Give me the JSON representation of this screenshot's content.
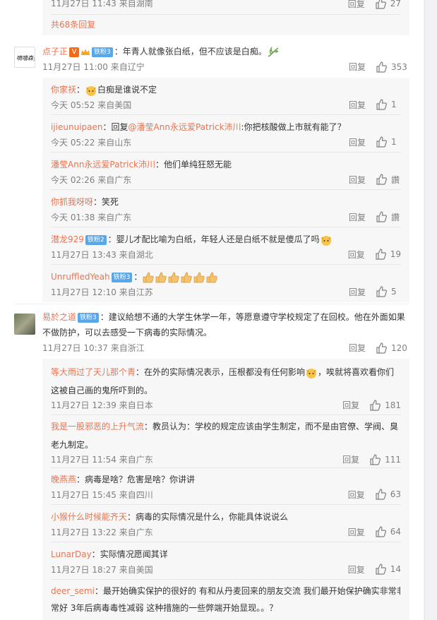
{
  "top_partial": {
    "meta": "11月27日 11:43 来自湖南",
    "reply": "回复",
    "likes": "27"
  },
  "more_replies": "共68条回复",
  "comments": [
    {
      "user": "点子正",
      "badge": "铁粉3",
      "text": "年青人就像张白纸，但不应该是白痴。",
      "meta": "11月27日 11:00 来自辽宁",
      "reply": "回复",
      "likes": "353",
      "replies": [
        {
          "user": "你家祆",
          "text_pre": "",
          "text": "白痴是谁说不定",
          "meta": "今天 05:52 来自美国",
          "reply": "回复",
          "likes": "1"
        },
        {
          "user": "ijieunuipaen",
          "text_pre": "回复",
          "mention": "@潘莹Ann永远爱Patrick沛川",
          "text": ":你把核酸做上市就有能了？",
          "meta": "今天 05:22 来自山东",
          "reply": "回复",
          "likes": "1"
        },
        {
          "user": "潘莹Ann永远爱Patrick沛川",
          "text_pre": "",
          "text": "他们单纯狂怒无能",
          "meta": "今天 02:26 来自广东",
          "reply": "回复",
          "likes": "讚"
        },
        {
          "user": "你抓我呀呀",
          "text_pre": "",
          "text": "笑死",
          "meta": "今天 01:38 来自广东",
          "reply": "回复",
          "likes": "讚"
        },
        {
          "user": "潜龙929",
          "badge": "铁粉2",
          "text_pre": "",
          "text": "婴儿才配比喻为白纸，年轻人还是白纸不就是傻瓜了吗",
          "meta": "11月27日 13:43 来自湖北",
          "reply": "回复",
          "likes": "19"
        },
        {
          "user": "UnruffledYeah",
          "badge": "铁粉3",
          "text_pre": "",
          "text": "",
          "meta": "11月27日 12:10 来自江苏",
          "reply": "回复",
          "likes": "5"
        }
      ]
    },
    {
      "user": "易於之道",
      "badge": "铁粉3",
      "text_line1": "建议給想不通的大学生休学一年，等愿意遵守学校规定了在回校。他在外面如果",
      "text_line2": "不做防护，可以去感受一下病毒的实际情况。",
      "meta": "11月27日 10:37 来自浙江",
      "reply": "回复",
      "likes": "120",
      "replies": [
        {
          "user": "等大雨过了天儿那个青",
          "text_line1": "在外的实际情况表示，压根都没有任何影响",
          "text_line1b": "，唉就将喜欢看你们",
          "text_line2": "这被自己画的鬼所吓到的。",
          "meta": "11月27日 12:39 来自日本",
          "reply": "回复",
          "likes": "181"
        },
        {
          "user": "我是一股邪恶的上升气流",
          "text_line1": "教员认为：学校的规定应该由学生制定，而不是由官僚、学阀、臭",
          "text_line2": "老九制定。",
          "meta": "11月27日 11:54 来自广东",
          "reply": "回复",
          "likes": "111"
        },
        {
          "user": "晚燕燕",
          "text": "病毒是啥？危害是啥？你讲讲",
          "meta": "11月27日 15:45 来自四川",
          "reply": "回复",
          "likes": "63"
        },
        {
          "user": "小猴什么时候能齐天",
          "text": "病毒的实际情况是什么，你能具体说说么",
          "meta": "11月27日 13:22 来自广东",
          "reply": "回复",
          "likes": "64"
        },
        {
          "user": "LunarDay",
          "text": "实际情况愿闻其详",
          "meta": "11月27日 18:27 来自美国",
          "reply": "回复",
          "likes": "14"
        },
        {
          "user": "deer_semi",
          "text_line1": "最开始确实保护的很好的 有和从丹麦回来的朋友交流 我们最开始保护确实非常非",
          "text_line2": "常好 3年后病毒毒性减弱 这种措施的一些弊端开始显现。。？"
        }
      ]
    }
  ],
  "colors": {
    "link": "#eb7350",
    "muted": "#808080",
    "badge": "#5aa7e8",
    "subbg": "#f7f7f7"
  }
}
